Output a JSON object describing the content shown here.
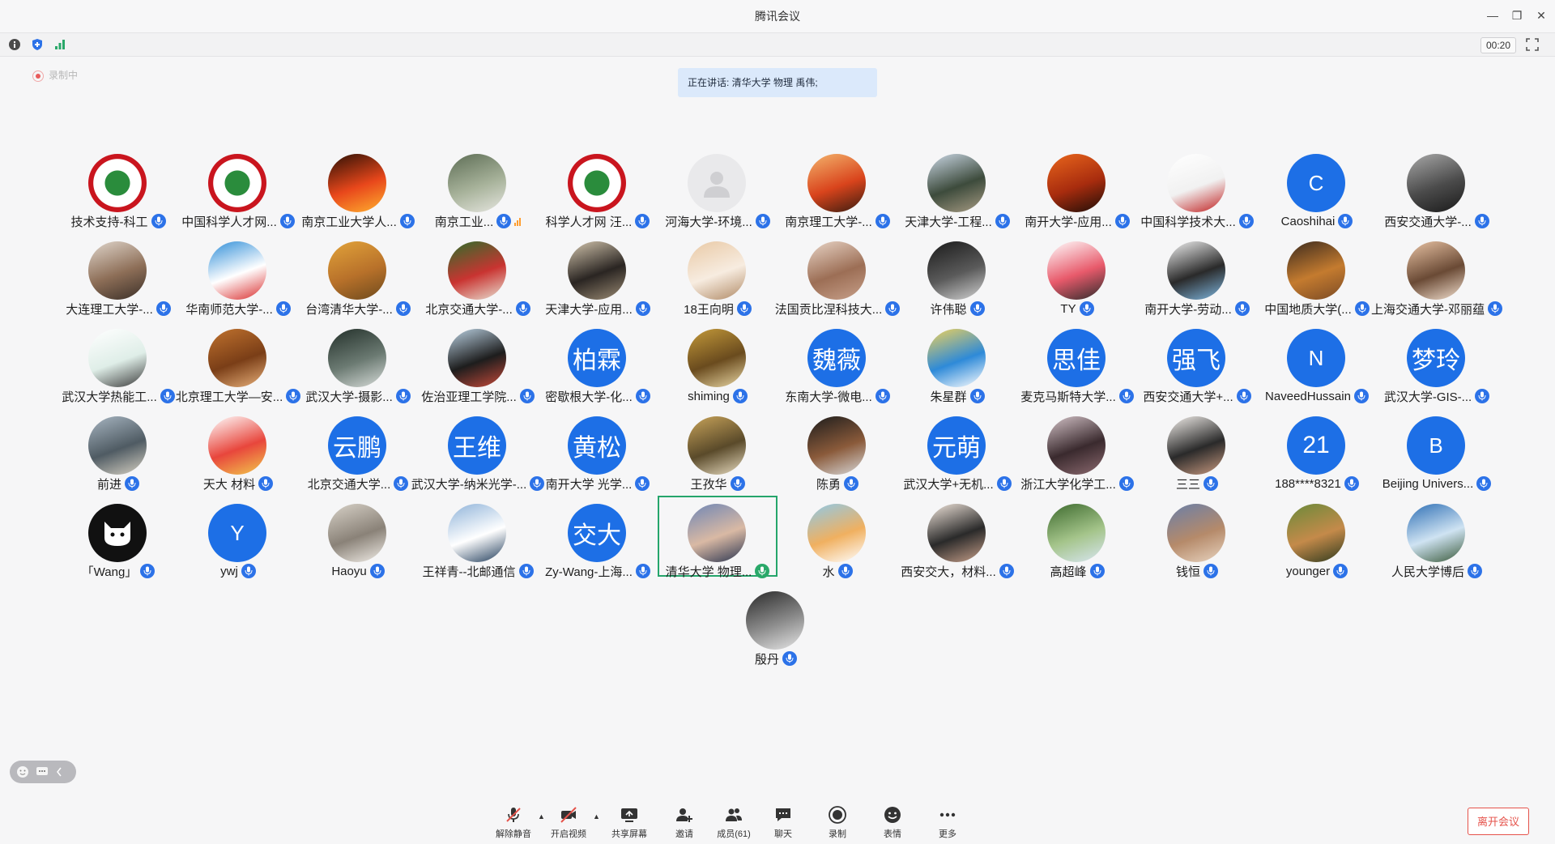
{
  "window": {
    "title": "腾讯会议"
  },
  "toolbar": {
    "timer": "00:20"
  },
  "recording": {
    "label": "录制中"
  },
  "banner": {
    "text": "正在讲话: 清华大学 物理 禹伟;"
  },
  "participants": [
    {
      "name": "技术支持-科工",
      "avatar": {
        "kind": "image",
        "icon": "emblem-icon",
        "colors": [
          "#c9151e",
          "#ffffff",
          "#2a8c3c"
        ]
      }
    },
    {
      "name": "中国科学人才网...",
      "avatar": {
        "kind": "image",
        "icon": "emblem-icon",
        "colors": [
          "#c9151e",
          "#ffffff",
          "#2a8c3c"
        ]
      }
    },
    {
      "name": "南京工业大学人...",
      "avatar": {
        "kind": "image",
        "icon": "photo-icon",
        "colors": [
          "#2a1005",
          "#e8471b",
          "#ffb12f"
        ]
      }
    },
    {
      "name": "南京工业...",
      "avatar": {
        "kind": "image",
        "icon": "photo-icon",
        "colors": [
          "#5d6d55",
          "#a7b29a",
          "#e6e6e0"
        ]
      },
      "speaking_bars": true
    },
    {
      "name": "科学人才网 汪...",
      "avatar": {
        "kind": "image",
        "icon": "emblem-icon",
        "colors": [
          "#c9151e",
          "#ffffff",
          "#2a8c3c"
        ]
      }
    },
    {
      "name": "河海大学-环境...",
      "avatar": {
        "kind": "image",
        "icon": "default-user-icon",
        "colors": [
          "#e9e9eb",
          "#cfcfd2",
          "#ffffff"
        ]
      }
    },
    {
      "name": "南京理工大学-...",
      "avatar": {
        "kind": "image",
        "icon": "photo-icon",
        "colors": [
          "#f4b56d",
          "#d9441c",
          "#381c10"
        ]
      }
    },
    {
      "name": "天津大学-工程...",
      "avatar": {
        "kind": "image",
        "icon": "photo-icon",
        "colors": [
          "#cbd8e6",
          "#3d4b3c",
          "#a89c84"
        ]
      }
    },
    {
      "name": "南开大学-应用...",
      "avatar": {
        "kind": "image",
        "icon": "photo-icon",
        "colors": [
          "#e9661c",
          "#a82c0e",
          "#1d0e08"
        ]
      }
    },
    {
      "name": "中国科学技术大...",
      "avatar": {
        "kind": "image",
        "icon": "photo-icon",
        "colors": [
          "#ffffff",
          "#f1f1f1",
          "#c01e1e"
        ]
      }
    },
    {
      "name": "Caoshihai",
      "avatar": {
        "kind": "text",
        "text": "C"
      }
    },
    {
      "name": "西安交通大学-...",
      "avatar": {
        "kind": "image",
        "icon": "photo-icon",
        "colors": [
          "#a9a9a9",
          "#4b4b4b",
          "#1a1a1a"
        ]
      }
    },
    {
      "name": "大连理工大学-...",
      "avatar": {
        "kind": "image",
        "icon": "photo-icon",
        "colors": [
          "#e0d6cc",
          "#8d6e57",
          "#3a2f28"
        ]
      }
    },
    {
      "name": "华南师范大学-...",
      "avatar": {
        "kind": "image",
        "icon": "photo-icon",
        "colors": [
          "#2f8ed8",
          "#ffffff",
          "#d92c2c"
        ]
      }
    },
    {
      "name": "台湾清华大学-...",
      "avatar": {
        "kind": "image",
        "icon": "photo-icon",
        "colors": [
          "#e2a33a",
          "#b8712a",
          "#6d4a1d"
        ]
      }
    },
    {
      "name": "北京交通大学-...",
      "avatar": {
        "kind": "image",
        "icon": "photo-icon",
        "colors": [
          "#2d6e2a",
          "#c93431",
          "#e8e2d4"
        ]
      }
    },
    {
      "name": "天津大学-应用...",
      "avatar": {
        "kind": "image",
        "icon": "photo-icon",
        "colors": [
          "#d4c6ae",
          "#2a2522",
          "#9b8b74"
        ]
      }
    },
    {
      "name": "18王向明",
      "avatar": {
        "kind": "image",
        "icon": "photo-icon",
        "colors": [
          "#e9c9a5",
          "#f7ece0",
          "#b08a66"
        ]
      }
    },
    {
      "name": "法国贡比涅科技大...",
      "avatar": {
        "kind": "image",
        "icon": "photo-icon",
        "colors": [
          "#e8d4c6",
          "#9c6e55",
          "#c7a08a"
        ]
      }
    },
    {
      "name": "许伟聪",
      "avatar": {
        "kind": "image",
        "icon": "photo-icon",
        "colors": [
          "#1a1a1a",
          "#5a5a5a",
          "#d2d2d2"
        ]
      }
    },
    {
      "name": "TY",
      "avatar": {
        "kind": "image",
        "icon": "photo-icon",
        "colors": [
          "#ffffff",
          "#e85a6b",
          "#2b2b2b"
        ]
      }
    },
    {
      "name": "南开大学-劳动...",
      "avatar": {
        "kind": "image",
        "icon": "photo-icon",
        "colors": [
          "#f2f2f2",
          "#2a2a2a",
          "#7fb7e0"
        ]
      }
    },
    {
      "name": "中国地质大学(...",
      "avatar": {
        "kind": "image",
        "icon": "photo-icon",
        "colors": [
          "#3b2a1e",
          "#c47b2f",
          "#7a4a25"
        ]
      }
    },
    {
      "name": "上海交通大学-邓丽蕴",
      "avatar": {
        "kind": "image",
        "icon": "photo-icon",
        "colors": [
          "#e9c3a4",
          "#6a4a35",
          "#f3e0cf"
        ]
      }
    },
    {
      "name": "武汉大学热能工...",
      "avatar": {
        "kind": "image",
        "icon": "photo-icon",
        "colors": [
          "#ffffff",
          "#dfeee8",
          "#3a3a3a"
        ]
      }
    },
    {
      "name": "北京理工大学—安...",
      "avatar": {
        "kind": "image",
        "icon": "photo-icon",
        "colors": [
          "#c0722e",
          "#7a3e17",
          "#e8b07a"
        ]
      }
    },
    {
      "name": "武汉大学-摄影...",
      "avatar": {
        "kind": "image",
        "icon": "photo-icon",
        "colors": [
          "#23302a",
          "#6b7a72",
          "#d7dcd9"
        ]
      }
    },
    {
      "name": "佐治亚理工学院...",
      "avatar": {
        "kind": "image",
        "icon": "photo-icon",
        "colors": [
          "#bcd3e4",
          "#1d1d1d",
          "#c84a3a"
        ]
      }
    },
    {
      "name": "密歇根大学-化...",
      "avatar": {
        "kind": "text",
        "text": "柏霖"
      }
    },
    {
      "name": "shiming",
      "avatar": {
        "kind": "image",
        "icon": "photo-icon",
        "colors": [
          "#c49a3a",
          "#6a4b1e",
          "#e9d7a4"
        ]
      }
    },
    {
      "name": "东南大学-微电...",
      "avatar": {
        "kind": "text",
        "text": "魏薇"
      }
    },
    {
      "name": "朱星群",
      "avatar": {
        "kind": "image",
        "icon": "photo-icon",
        "colors": [
          "#f0d25a",
          "#2e8ad8",
          "#ffffff"
        ]
      }
    },
    {
      "name": "麦克马斯特大学...",
      "avatar": {
        "kind": "text",
        "text": "思佳"
      }
    },
    {
      "name": "西安交通大学+...",
      "avatar": {
        "kind": "text",
        "text": "强飞"
      }
    },
    {
      "name": "NaveedHussain",
      "avatar": {
        "kind": "text",
        "text": "N"
      }
    },
    {
      "name": "武汉大学-GIS-...",
      "avatar": {
        "kind": "text",
        "text": "梦玲"
      }
    },
    {
      "name": "前进",
      "avatar": {
        "kind": "image",
        "icon": "photo-icon",
        "colors": [
          "#a8b6c2",
          "#4f5b63",
          "#d7d1c3"
        ]
      }
    },
    {
      "name": "天大 材料",
      "avatar": {
        "kind": "image",
        "icon": "photo-icon",
        "colors": [
          "#ffffff",
          "#e8463c",
          "#f2c94c"
        ]
      }
    },
    {
      "name": "北京交通大学...",
      "avatar": {
        "kind": "text",
        "text": "云鹏"
      }
    },
    {
      "name": "武汉大学-纳米光学-...",
      "avatar": {
        "kind": "text",
        "text": "王维"
      }
    },
    {
      "name": "南开大学 光学...",
      "avatar": {
        "kind": "text",
        "text": "黄松"
      }
    },
    {
      "name": "王孜华",
      "avatar": {
        "kind": "image",
        "icon": "photo-icon",
        "colors": [
          "#c9a45a",
          "#5a4a2a",
          "#e8dcc0"
        ]
      }
    },
    {
      "name": "陈勇",
      "avatar": {
        "kind": "image",
        "icon": "photo-icon",
        "colors": [
          "#1c1c1c",
          "#8a5a3a",
          "#d8d8d8"
        ]
      }
    },
    {
      "name": "武汉大学+无机...",
      "avatar": {
        "kind": "text",
        "text": "元萌"
      }
    },
    {
      "name": "浙江大学化学工...",
      "avatar": {
        "kind": "image",
        "icon": "photo-icon",
        "colors": [
          "#d4c3c8",
          "#3a2a2e",
          "#8c6a70"
        ]
      }
    },
    {
      "name": "三三",
      "avatar": {
        "kind": "image",
        "icon": "photo-icon",
        "colors": [
          "#f4f0ec",
          "#2a2a2a",
          "#c99a80"
        ]
      }
    },
    {
      "name": "188****8321",
      "avatar": {
        "kind": "text",
        "text": "21"
      }
    },
    {
      "name": "Beijing Univers...",
      "avatar": {
        "kind": "text",
        "text": "B"
      }
    },
    {
      "name": "「Wang」",
      "avatar": {
        "kind": "image",
        "icon": "cat-icon",
        "colors": [
          "#111111",
          "#ffffff",
          "#111111"
        ]
      }
    },
    {
      "name": "ywj",
      "avatar": {
        "kind": "text",
        "text": "Y"
      }
    },
    {
      "name": "Haoyu",
      "avatar": {
        "kind": "image",
        "icon": "photo-icon",
        "colors": [
          "#d8d2c8",
          "#8a8278",
          "#f2eee8"
        ]
      }
    },
    {
      "name": "王祥青--北邮通信",
      "avatar": {
        "kind": "image",
        "icon": "photo-icon",
        "colors": [
          "#8fb3d9",
          "#ffffff",
          "#1f3b5a"
        ]
      }
    },
    {
      "name": "Zy-Wang-上海...",
      "avatar": {
        "kind": "text",
        "text": "交大"
      }
    },
    {
      "name": "清华大学 物理...",
      "avatar": {
        "kind": "image",
        "icon": "photo-icon",
        "colors": [
          "#6f86b5",
          "#d9b9a4",
          "#2a3550"
        ]
      },
      "active": true
    },
    {
      "name": "水",
      "avatar": {
        "kind": "image",
        "icon": "photo-icon",
        "colors": [
          "#8fc9e8",
          "#f0b060",
          "#ffffff"
        ]
      }
    },
    {
      "name": "西安交大，材料...",
      "avatar": {
        "kind": "image",
        "icon": "photo-icon",
        "colors": [
          "#f2e6dc",
          "#2a2a2a",
          "#c8a08a"
        ]
      }
    },
    {
      "name": "高超峰",
      "avatar": {
        "kind": "image",
        "icon": "photo-icon",
        "colors": [
          "#3d6a2e",
          "#a4c48a",
          "#d8e6f2"
        ]
      }
    },
    {
      "name": "钱恒",
      "avatar": {
        "kind": "image",
        "icon": "photo-icon",
        "colors": [
          "#6a7fa8",
          "#b58a6a",
          "#e8d4c0"
        ]
      }
    },
    {
      "name": "younger",
      "avatar": {
        "kind": "image",
        "icon": "photo-icon",
        "colors": [
          "#6a8a3a",
          "#c48a4a",
          "#2e3a1e"
        ]
      }
    },
    {
      "name": "人民大学博后",
      "avatar": {
        "kind": "image",
        "icon": "photo-icon",
        "colors": [
          "#2e6fb5",
          "#cfe3f2",
          "#3a5a3a"
        ]
      }
    },
    {
      "name": "殷丹",
      "avatar": {
        "kind": "image",
        "icon": "photo-icon",
        "colors": [
          "#2a2a2a",
          "#8c8c8c",
          "#e6e6e6"
        ]
      }
    }
  ],
  "controls": {
    "unmute": "解除静音",
    "video": "开启视频",
    "share": "共享屏幕",
    "invite": "邀请",
    "members": "成员(61)",
    "chat": "聊天",
    "record": "录制",
    "reactions": "表情",
    "more": "更多"
  },
  "leave_button": "离开会议",
  "colors": {
    "accent": "#1d6fe6",
    "active_border": "#25a56b",
    "leave": "#e5534b",
    "banner_bg": "#dbe9fb"
  }
}
